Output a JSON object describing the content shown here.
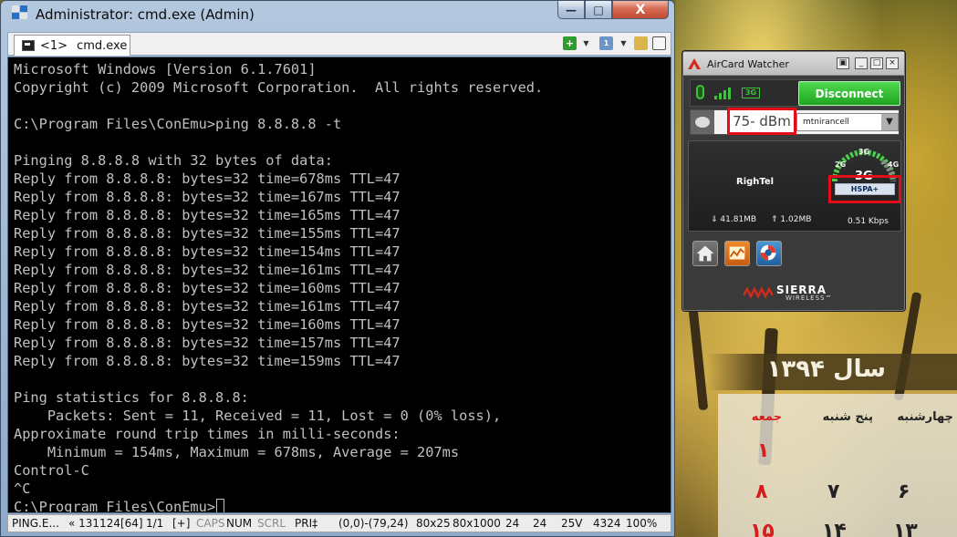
{
  "window": {
    "title": "Administrator: cmd.exe (Admin)",
    "minimize_label": "—",
    "maximize_label": "□",
    "close_label": "X"
  },
  "tabs": [
    {
      "number": "<1>",
      "title": "cmd.exe"
    }
  ],
  "console": {
    "lines": [
      "Microsoft Windows [Version 6.1.7601]",
      "Copyright (c) 2009 Microsoft Corporation.  All rights reserved.",
      "",
      "C:\\Program Files\\ConEmu>ping 8.8.8.8 -t",
      "",
      "Pinging 8.8.8.8 with 32 bytes of data:",
      "Reply from 8.8.8.8: bytes=32 time=678ms TTL=47",
      "Reply from 8.8.8.8: bytes=32 time=167ms TTL=47",
      "Reply from 8.8.8.8: bytes=32 time=165ms TTL=47",
      "Reply from 8.8.8.8: bytes=32 time=155ms TTL=47",
      "Reply from 8.8.8.8: bytes=32 time=154ms TTL=47",
      "Reply from 8.8.8.8: bytes=32 time=161ms TTL=47",
      "Reply from 8.8.8.8: bytes=32 time=160ms TTL=47",
      "Reply from 8.8.8.8: bytes=32 time=161ms TTL=47",
      "Reply from 8.8.8.8: bytes=32 time=160ms TTL=47",
      "Reply from 8.8.8.8: bytes=32 time=157ms TTL=47",
      "Reply from 8.8.8.8: bytes=32 time=159ms TTL=47",
      "",
      "Ping statistics for 8.8.8.8:",
      "    Packets: Sent = 11, Received = 11, Lost = 0 (0% loss),",
      "Approximate round trip times in milli-seconds:",
      "    Minimum = 154ms, Maximum = 678ms, Average = 207ms",
      "Control-C",
      "^C"
    ],
    "prompt": "C:\\Program Files\\ConEmu>"
  },
  "statusbar": {
    "process": "PING.E...",
    "process_info": "« 131124[64]",
    "console_index": "1/1",
    "plus": "[+]",
    "caps": "CAPS",
    "num": "NUM",
    "scrl": "SCRL",
    "pri": "PRI‡",
    "selection": "(0,0)-(79,24)",
    "size": "80x25",
    "buffer": "80x1000",
    "val1": "24",
    "val2": "24",
    "voltage": "25V",
    "codepage": "4324",
    "zoom": "100%"
  },
  "aircard": {
    "title": "AirCard Watcher",
    "tech_small": "3G",
    "disconnect_label": "Disconnect",
    "signal": "75- dBm",
    "operator": "mtnirancell",
    "network_name": "RighTel",
    "gauge_labels": [
      "2G",
      "3G",
      "4G",
      "3G"
    ],
    "technology": "HSPA+",
    "download": "41.81MB",
    "upload": "1.02MB",
    "rate": "0.51 Kbps",
    "brand_name": "SIERRA",
    "brand_sub": "WIRELESS™"
  },
  "calendar": {
    "year_title": "سال ۱۳۹۴",
    "day_headers": [
      "جمعه",
      "پنج شنبه",
      "چهارشنبه"
    ],
    "numbers": [
      "۱",
      "۸",
      "۷",
      "۶",
      "۱۵",
      "۱۴",
      "۱۳"
    ]
  },
  "colors": {
    "console_bg": "#000000",
    "console_text": "#c0c0c0",
    "highlight_red": "#e10d18",
    "connect_green": "#2fbf2f"
  }
}
